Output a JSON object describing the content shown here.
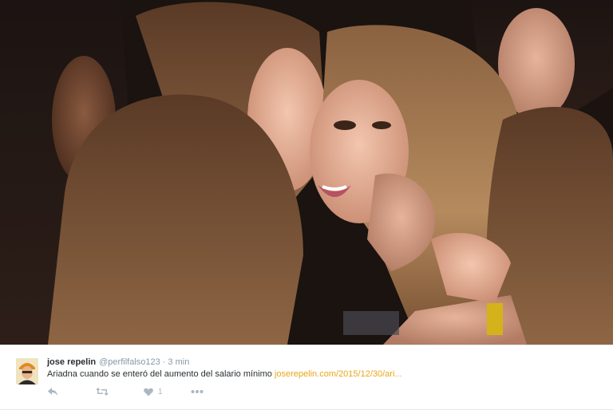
{
  "tweet": {
    "author_name": "jose repelin",
    "handle": "@perfilfalso123",
    "separator": "·",
    "time": "3 min",
    "text": "Ariadna cuando se enteró del aumento del salario mínimo",
    "link": "joserepelin.com/2015/12/30/ari...",
    "like_count": "1"
  },
  "icons": {
    "reply": "reply-icon",
    "retweet": "retweet-icon",
    "like": "heart-icon",
    "more": "more-dots-icon"
  },
  "colors": {
    "link": "#e8a717",
    "name": "#292f33",
    "meta": "#8899a6",
    "action": "#aab8c2"
  }
}
